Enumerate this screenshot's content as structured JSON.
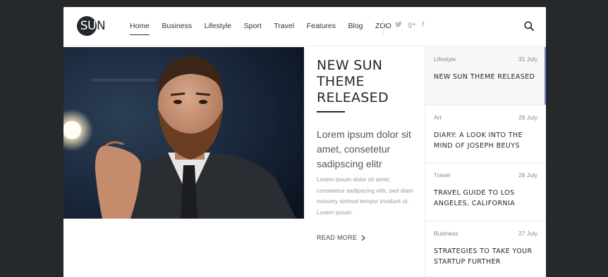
{
  "logo": {
    "mark": "SU",
    "rest": "N"
  },
  "nav": {
    "items": [
      {
        "label": "Home",
        "active": true
      },
      {
        "label": "Business",
        "active": false
      },
      {
        "label": "Lifestyle",
        "active": false
      },
      {
        "label": "Sport",
        "active": false
      },
      {
        "label": "Travel",
        "active": false
      },
      {
        "label": "Features",
        "active": false
      },
      {
        "label": "Blog",
        "active": false
      },
      {
        "label": "ZOO",
        "active": false
      }
    ],
    "social": [
      {
        "icon": "twitter-icon",
        "glyph": "🐦"
      },
      {
        "icon": "google-plus-icon",
        "glyph": "g+"
      },
      {
        "icon": "facebook-icon",
        "glyph": "f"
      }
    ],
    "search_icon": "search-icon"
  },
  "article": {
    "title": "NEW SUN\nTHEME\nRELEASED",
    "lead": "Lorem ipsum dolor sit amet, consetetur sadipscing elitr",
    "body": "Lorem ipsum dolor sit amet, consetetur sadipscing elitr, sed diam nonumy eirmod tempor invidunt ut. Lorem ipsum.",
    "read_more": "READ MORE"
  },
  "sidebar": {
    "items": [
      {
        "category": "Lifestyle",
        "date": "31 July",
        "title": "NEW SUN THEME RELEASED",
        "active": true
      },
      {
        "category": "Art",
        "date": "29 July",
        "title": "DIARY: A LOOK INTO THE MIND OF JOSEPH BEUYS",
        "active": false
      },
      {
        "category": "Travel",
        "date": "28 July",
        "title": "TRAVEL GUIDE TO LOS ANGELES, CALIFORNIA",
        "active": false
      },
      {
        "category": "Business",
        "date": "27 July",
        "title": "STRATEGIES TO TAKE YOUR STARTUP FURTHER",
        "active": false
      }
    ]
  },
  "colors": {
    "background": "#25292c",
    "text_dark": "#23282d",
    "accent": "#6f87c7"
  }
}
